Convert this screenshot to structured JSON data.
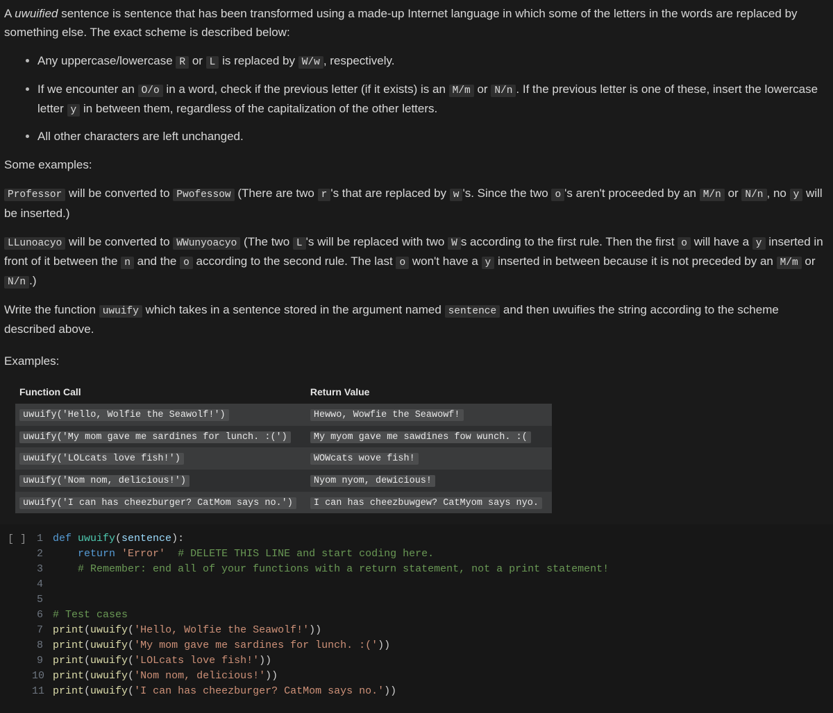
{
  "intro": {
    "p1_a": "A ",
    "p1_em": "uwuified",
    "p1_b": " sentence is sentence that has been transformed using a made-up Internet language in which some of the letters in the words are replaced by something else. The exact scheme is described below:"
  },
  "rules": {
    "r1": {
      "a": "Any uppercase/lowercase ",
      "c1": "R",
      "b": " or ",
      "c2": "L",
      "c": " is replaced by ",
      "c3": "W/w",
      "d": ", respectively."
    },
    "r2": {
      "a": "If we encounter an ",
      "c1": "O/o",
      "b": " in a word, check if the previous letter (if it exists) is an ",
      "c2": "M/m",
      "c": " or ",
      "c3": "N/n",
      "d": ". If the previous letter is one of these, insert the lowercase letter ",
      "c4": "y",
      "e": " in between them, regardless of the capitalization of the other letters."
    },
    "r3": "All other characters are left unchanged."
  },
  "some_examples": "Some examples:",
  "ex1": {
    "c1": "Professor",
    "a": " will be converted to ",
    "c2": "Pwofessow",
    "b": " (There are two ",
    "c3": "r",
    "c": "'s that are replaced by ",
    "c4": "w",
    "d": "'s. Since the two ",
    "c5": "o",
    "e": "'s aren't proceeded by an ",
    "c6": "M/n",
    "f": " or ",
    "c7": "N/n",
    "g": ", no ",
    "c8": "y",
    "h": " will be inserted.)"
  },
  "ex2": {
    "c1": "LLunoacyo",
    "a": " will be converted to ",
    "c2": "WWunyoacyo",
    "b": " (The two ",
    "c3": "L",
    "c": "'s will be replaced with two ",
    "c4": "W",
    "d": "s according to the first rule. Then the first ",
    "c5": "o",
    "e": " will have a ",
    "c6": "y",
    "f": " inserted in front of it between the ",
    "c7": "n",
    "g": " and the ",
    "c8": "o",
    "h": " according to the second rule. The last ",
    "c9": "o",
    "i": " won't have a ",
    "c10": "y",
    "j": " inserted in between because it is not preceded by an ",
    "c11": "M/m",
    "k": " or ",
    "c12": "N/n",
    "l": ".)"
  },
  "task": {
    "a": "Write the function ",
    "c1": "uwuify",
    "b": " which takes in a sentence stored in the argument named ",
    "c2": "sentence",
    "c": " and then uwuifies the string according to the scheme described above."
  },
  "examples_label": "Examples:",
  "table": {
    "headers": {
      "fn": "Function Call",
      "ret": "Return Value"
    },
    "rows": [
      {
        "call": "uwuify('Hello, Wolfie the Seawolf!')",
        "ret": "Hewwo, Wowfie the Seawowf!"
      },
      {
        "call": "uwuify('My mom gave me sardines for lunch. :(')",
        "ret": "My myom gave me sawdines fow wunch. :("
      },
      {
        "call": "uwuify('LOLcats love fish!')",
        "ret": "WOWcats wove fish!"
      },
      {
        "call": "uwuify('Nom nom, delicious!')",
        "ret": "Nyom nyom, dewicious!"
      },
      {
        "call": "uwuify('I can has cheezburger? CatMom says no.')",
        "ret": "I can has cheezbuwgew? CatMyom says nyo."
      }
    ]
  },
  "code": {
    "prompt": "[ ]",
    "lines": [
      {
        "n": "1",
        "t": [
          [
            "kw",
            "def "
          ],
          [
            "fn",
            "uwuify"
          ],
          [
            "punc",
            "("
          ],
          [
            "param",
            "sentence"
          ],
          [
            "punc",
            "):"
          ]
        ]
      },
      {
        "n": "2",
        "t": [
          [
            "punc",
            "    "
          ],
          [
            "kw",
            "return "
          ],
          [
            "str",
            "'Error'"
          ],
          [
            "punc",
            "  "
          ],
          [
            "com",
            "# DELETE THIS LINE and start coding here."
          ]
        ]
      },
      {
        "n": "3",
        "t": [
          [
            "punc",
            "    "
          ],
          [
            "com",
            "# Remember: end all of your functions with a return statement, not a print statement!"
          ]
        ]
      },
      {
        "n": "4",
        "t": []
      },
      {
        "n": "5",
        "t": []
      },
      {
        "n": "6",
        "t": [
          [
            "com",
            "# Test cases"
          ]
        ]
      },
      {
        "n": "7",
        "t": [
          [
            "call",
            "print"
          ],
          [
            "punc",
            "("
          ],
          [
            "call",
            "uwuify"
          ],
          [
            "punc",
            "("
          ],
          [
            "str",
            "'Hello, Wolfie the Seawolf!'"
          ],
          [
            "punc",
            "))"
          ]
        ]
      },
      {
        "n": "8",
        "t": [
          [
            "call",
            "print"
          ],
          [
            "punc",
            "("
          ],
          [
            "call",
            "uwuify"
          ],
          [
            "punc",
            "("
          ],
          [
            "str",
            "'My mom gave me sardines for lunch. :('"
          ],
          [
            "punc",
            "))"
          ]
        ]
      },
      {
        "n": "9",
        "t": [
          [
            "call",
            "print"
          ],
          [
            "punc",
            "("
          ],
          [
            "call",
            "uwuify"
          ],
          [
            "punc",
            "("
          ],
          [
            "str",
            "'LOLcats love fish!'"
          ],
          [
            "punc",
            "))"
          ]
        ]
      },
      {
        "n": "10",
        "t": [
          [
            "call",
            "print"
          ],
          [
            "punc",
            "("
          ],
          [
            "call",
            "uwuify"
          ],
          [
            "punc",
            "("
          ],
          [
            "str",
            "'Nom nom, delicious!'"
          ],
          [
            "punc",
            "))"
          ]
        ]
      },
      {
        "n": "11",
        "t": [
          [
            "call",
            "print"
          ],
          [
            "punc",
            "("
          ],
          [
            "call",
            "uwuify"
          ],
          [
            "punc",
            "("
          ],
          [
            "str",
            "'I can has cheezburger? CatMom says no.'"
          ],
          [
            "punc",
            "))"
          ]
        ]
      }
    ]
  }
}
